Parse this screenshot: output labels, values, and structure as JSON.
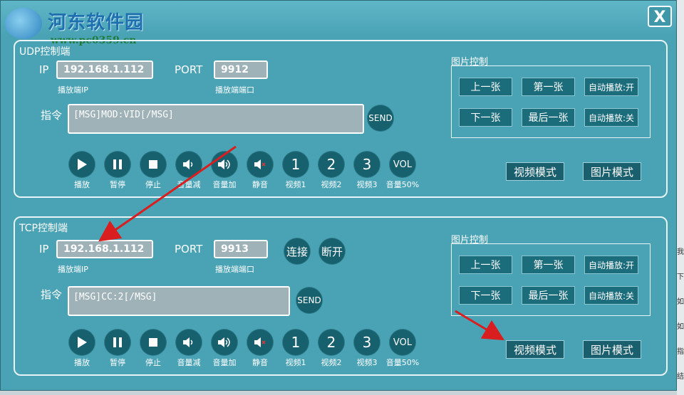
{
  "window": {
    "watermark_logo": "河东软件园",
    "watermark_url": "www.pc0359.cn",
    "close_label": "X"
  },
  "udp": {
    "title": "UDP控制端",
    "ip_label": "IP",
    "ip_value": "192.168.1.112",
    "ip_hint": "播放端IP",
    "port_label": "PORT",
    "port_value": "9912",
    "port_hint": "播放端端口",
    "cmd_label": "指令",
    "cmd_value": "[MSG]MOD:VID[/MSG]",
    "send_label": "SEND",
    "image_control": {
      "title": "图片控制",
      "prev": "上一张",
      "first": "第一张",
      "auto_on": "自动播放:开",
      "next": "下一张",
      "last": "最后一张",
      "auto_off": "自动播放:关"
    },
    "video_mode": "视频模式",
    "image_mode": "图片模式"
  },
  "tcp": {
    "title": "TCP控制端",
    "ip_label": "IP",
    "ip_value": "192.168.1.112",
    "ip_hint": "播放端IP",
    "port_label": "PORT",
    "port_value": "9913",
    "port_hint": "播放端端口",
    "connect_label": "连接",
    "disconnect_label": "断开",
    "cmd_label": "指令",
    "cmd_value": "[MSG]CC:2[/MSG]",
    "send_label": "SEND",
    "image_control": {
      "title": "图片控制",
      "prev": "上一张",
      "first": "第一张",
      "auto_on": "自动播放:开",
      "next": "下一张",
      "last": "最后一张",
      "auto_off": "自动播放:关"
    },
    "video_mode": "视频模式",
    "image_mode": "图片模式"
  },
  "controls": {
    "play": "播放",
    "pause": "暂停",
    "stop": "停止",
    "vol_down": "音量减",
    "vol_up": "音量加",
    "mute": "静音",
    "video1_num": "1",
    "video1": "视频1",
    "video2_num": "2",
    "video2": "视频2",
    "video3_num": "3",
    "video3": "视频3",
    "vol50_icon": "VOL",
    "vol50": "音量50%"
  },
  "icons": [
    "play-icon",
    "pause-icon",
    "stop-icon",
    "volume-down-icon",
    "volume-up-icon",
    "mute-icon"
  ],
  "side_strip_text": [
    "我",
    "下",
    "如",
    "如",
    "指",
    "结"
  ],
  "colors": {
    "window_bg": "#4aa3b5",
    "button_bg": "#17606e",
    "arrow": "#d81e1e"
  }
}
